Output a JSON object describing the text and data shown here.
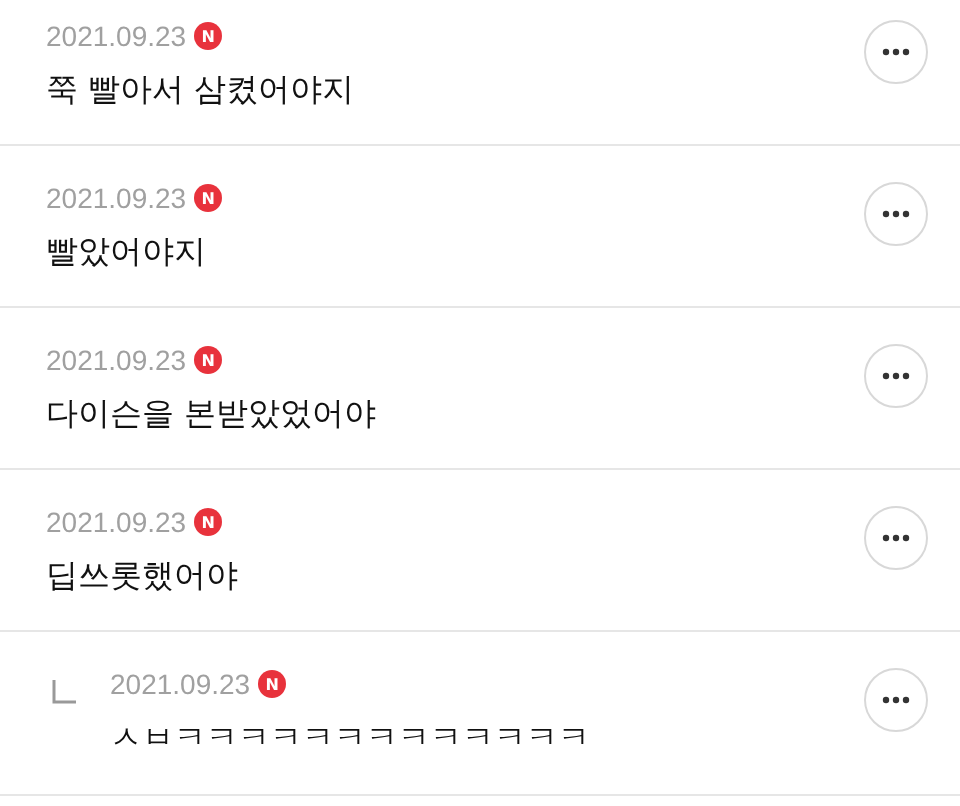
{
  "comments": [
    {
      "kind": "comment",
      "date": "2021.09.23",
      "badge": "N",
      "text": "쭉 빨아서 삼켰어야지"
    },
    {
      "kind": "comment",
      "date": "2021.09.23",
      "badge": "N",
      "text": "빨았어야지"
    },
    {
      "kind": "comment",
      "date": "2021.09.23",
      "badge": "N",
      "text": "다이슨을 본받았었어야"
    },
    {
      "kind": "comment",
      "date": "2021.09.23",
      "badge": "N",
      "text": "딥쓰롯했어야"
    },
    {
      "kind": "reply",
      "date": "2021.09.23",
      "badge": "N",
      "text": "ㅅㅂㅋㅋㅋㅋㅋㅋㅋㅋㅋㅋㅋㅋㅋ"
    }
  ]
}
